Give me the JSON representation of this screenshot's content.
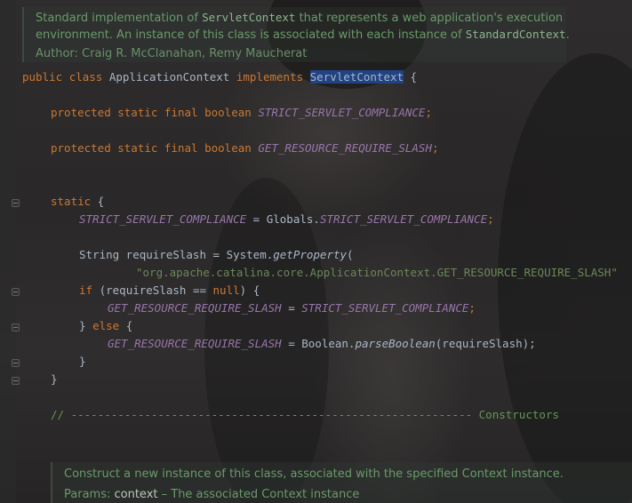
{
  "doc_top": {
    "line1_a": "Standard implementation of ",
    "line1_code": "ServletContext",
    "line1_b": " that represents a web application's execution",
    "line2_a": "environment. An instance of this class is associated with each instance of ",
    "line2_code": "StandardContext",
    "line2_b": ".",
    "author": "Author: Craig R. McClanahan, Remy Maucherat"
  },
  "code": {
    "l1_public": "public",
    "l1_class": "class",
    "l1_name": "ApplicationContext",
    "l1_implements": "implements",
    "l1_iface": "ServletContext",
    "l1_brace": " {",
    "l2_mods": "protected static final boolean",
    "l2_field": "STRICT_SERVLET_COMPLIANCE",
    "l2_semi": ";",
    "l3_mods": "protected static final boolean",
    "l3_field": "GET_RESOURCE_REQUIRE_SLASH",
    "l3_semi": ";",
    "l4_static": "static",
    "l4_brace": " {",
    "l5_field": "STRICT_SERVLET_COMPLIANCE",
    "l5_mid": " = Globals.",
    "l5_value": "STRICT_SERVLET_COMPLIANCE",
    "l5_semi": ";",
    "l6_a": "String requireSlash = System.",
    "l6_method": "getProperty",
    "l6_paren": "(",
    "l7_string": "\"org.apache.catalina.core.ApplicationContext.GET_RESOURCE_REQUIRE_SLASH\"",
    "l8_if": "if",
    "l8_a": " (requireSlash == ",
    "l8_null": "null",
    "l8_b": ") {",
    "l9_field": "GET_RESOURCE_REQUIRE_SLASH",
    "l9_mid": " = ",
    "l9_value": "STRICT_SERVLET_COMPLIANCE",
    "l9_semi": ";",
    "l10_a": "} ",
    "l10_else": "else",
    "l10_b": " {",
    "l11_field": "GET_RESOURCE_REQUIRE_SLASH",
    "l11_mid": " = Boolean.",
    "l11_method": "parseBoolean",
    "l11_b": "(requireSlash);",
    "l12": "}",
    "l13": "}",
    "l14_comment": "// ------------------------------------------------------------ Constructors"
  },
  "doc_bottom": {
    "line1": "Construct a new instance of this class, associated with the specified Context instance.",
    "params_label": "Params: ",
    "param_name": "context",
    "param_desc": " – The associated Context instance"
  }
}
